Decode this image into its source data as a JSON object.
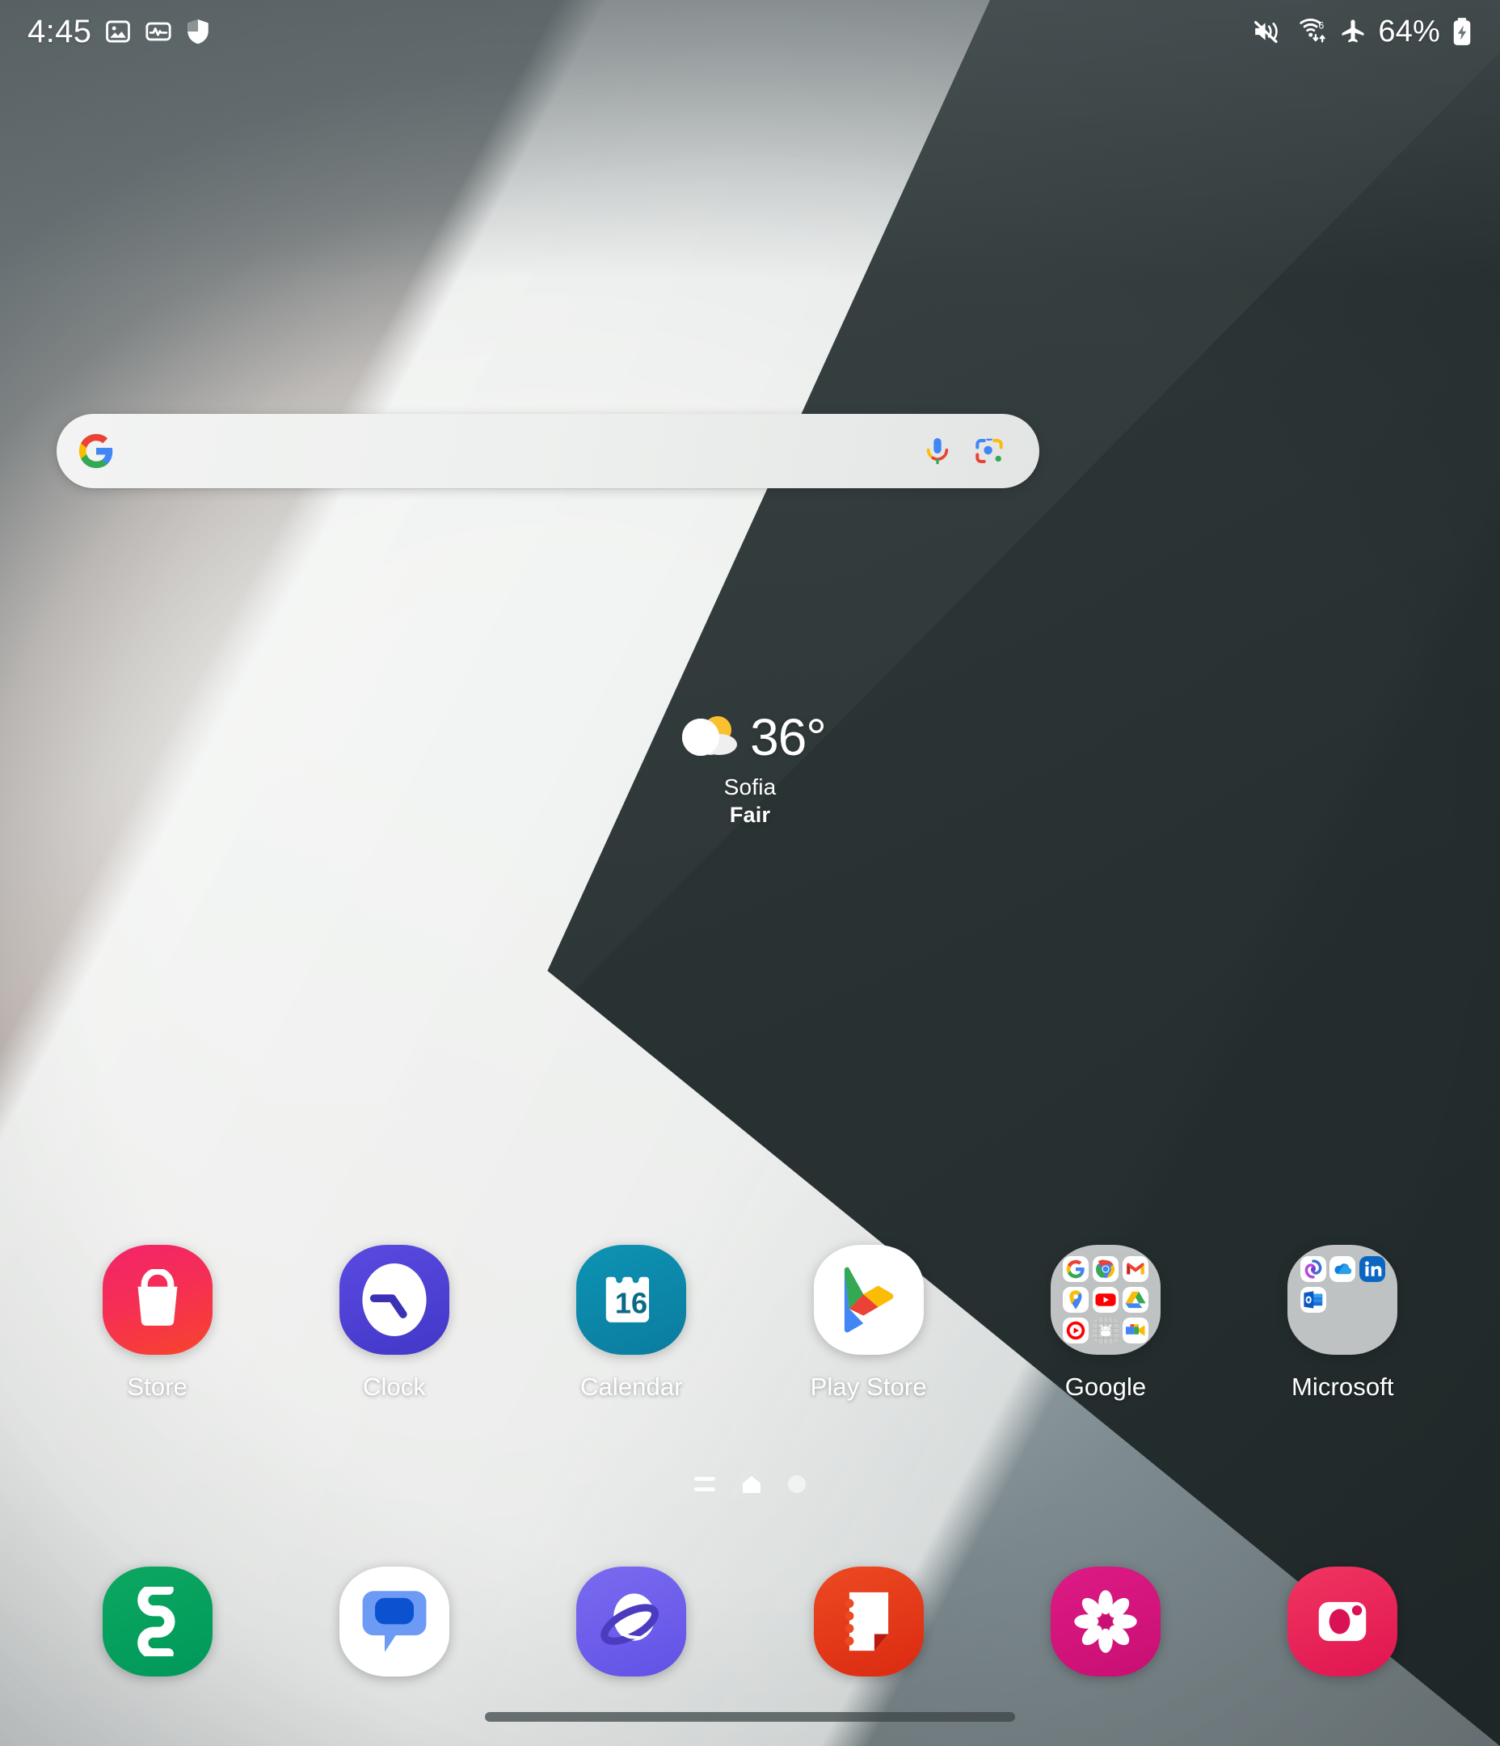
{
  "status_bar": {
    "time": "4:45",
    "battery_percent": "64%",
    "left_icons": [
      {
        "name": "photos-icon",
        "label": "Photos"
      },
      {
        "name": "health-monitor-icon",
        "label": "Health monitor"
      },
      {
        "name": "security-shield-icon",
        "label": "Security"
      }
    ],
    "right_icons": [
      {
        "name": "mute-vibrate-icon",
        "label": "Sound off / vibrate"
      },
      {
        "name": "wifi-6-icon",
        "label": "Wi-Fi 6"
      },
      {
        "name": "airplane-mode-icon",
        "label": "Airplane mode"
      },
      {
        "name": "battery-charging-icon",
        "label": "Battery charging"
      }
    ]
  },
  "search": {
    "value": "",
    "placeholder": "",
    "google_logo": "google-g-icon",
    "mic_icon": "microphone-icon",
    "lens_icon": "google-lens-icon"
  },
  "weather": {
    "temperature": "36°",
    "city": "Sofia",
    "condition": "Fair",
    "icon": "partly-cloudy-icon"
  },
  "apps": [
    {
      "label": "Store",
      "icon": "galaxy-store-icon"
    },
    {
      "label": "Clock",
      "icon": "clock-icon"
    },
    {
      "label": "Calendar",
      "icon": "calendar-icon",
      "day": "16"
    },
    {
      "label": "Play Store",
      "icon": "play-store-icon"
    },
    {
      "label": "Google",
      "icon": "google-folder-icon",
      "folder_items": [
        "google-search",
        "chrome",
        "gmail",
        "maps",
        "youtube",
        "drive",
        "youtube-music",
        "play-games",
        "meet"
      ]
    },
    {
      "label": "Microsoft",
      "icon": "microsoft-folder-icon",
      "folder_items": [
        "copilot",
        "onedrive",
        "linkedin",
        "outlook"
      ]
    }
  ],
  "page_indicator": {
    "app_list_icon": "app-list-icon",
    "home_icon": "home-icon",
    "pages": 2,
    "active_page": 1
  },
  "dock": [
    {
      "label": "Phone",
      "icon": "phone-icon"
    },
    {
      "label": "Messages",
      "icon": "messages-icon"
    },
    {
      "label": "Samsung Internet",
      "icon": "internet-icon"
    },
    {
      "label": "Samsung Notes",
      "icon": "notes-icon"
    },
    {
      "label": "Gallery",
      "icon": "gallery-icon"
    },
    {
      "label": "Camera",
      "icon": "camera-icon"
    }
  ],
  "nav_bar": {
    "gesture_handle": "gesture-handle"
  },
  "colors": {
    "google_blue": "#4285F4",
    "google_red": "#EA4335",
    "google_yellow": "#FBBC05",
    "google_green": "#34A853",
    "store_pink": "#F5265C",
    "clock_purple": "#4B43CC",
    "calendar_teal": "#0B86A8",
    "phone_green": "#00A05A",
    "notes_red": "#E2401B",
    "gallery_magenta": "#D4157E",
    "camera_crimson": "#E8325C",
    "internet_purple": "#6B5CE7"
  }
}
